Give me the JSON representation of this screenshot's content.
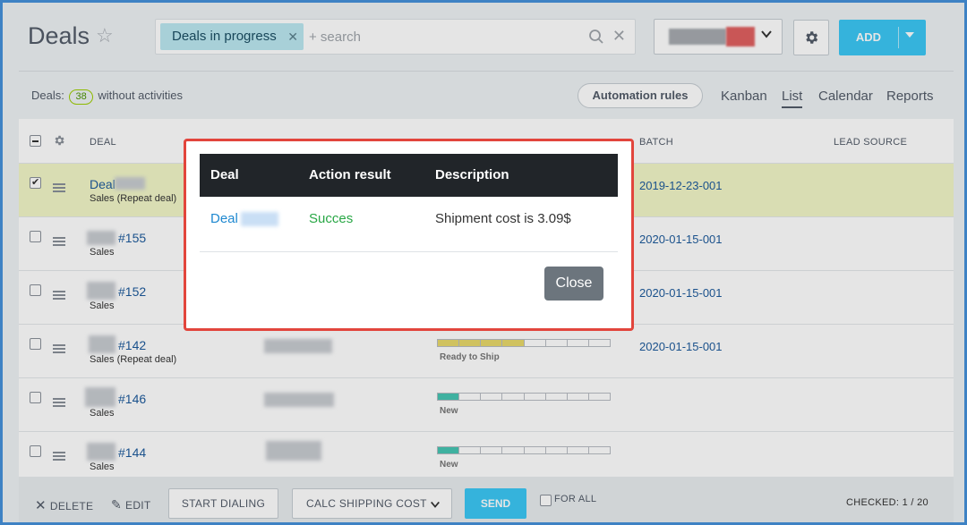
{
  "header": {
    "title": "Deals",
    "filter_tag": "Deals in progress",
    "search_placeholder": "+ search",
    "add_label": "ADD"
  },
  "toolbar": {
    "counter_prefix": "Deals:",
    "counter_value": "38",
    "counter_suffix": "without activities",
    "automation_label": "Automation rules",
    "views": [
      "Kanban",
      "List",
      "Calendar",
      "Reports"
    ],
    "active_view": "List"
  },
  "table": {
    "columns": {
      "deal": "DEAL",
      "batch": "BATCH",
      "lead_source": "LEAD SOURCE"
    },
    "rows": [
      {
        "title": "Deal",
        "subtitle": "Sales (Repeat deal)",
        "batch": "2019-12-23-001",
        "checked": true
      },
      {
        "title": "#155",
        "subtitle": "Sales",
        "batch": "2020-01-15-001",
        "checked": false
      },
      {
        "title": "#152",
        "subtitle": "Sales",
        "batch": "2020-01-15-001",
        "checked": false
      },
      {
        "title": "#142",
        "subtitle": "Sales (Repeat deal)",
        "batch": "2020-01-15-001",
        "checked": false,
        "stage": "Ready to Ship",
        "stage_progress": 0.55
      },
      {
        "title": "#146",
        "subtitle": "Sales",
        "batch": "",
        "checked": false,
        "stage": "New",
        "stage_progress": 0.15
      },
      {
        "title": "#144",
        "subtitle": "Sales",
        "batch": "",
        "checked": false,
        "stage": "New",
        "stage_progress": 0.15
      }
    ]
  },
  "footer": {
    "delete": "DELETE",
    "edit": "EDIT",
    "start_dialing": "START DIALING",
    "action_select": "CALC SHIPPING COST",
    "send": "SEND",
    "for_all": "FOR ALL",
    "checked": "CHECKED: 1 / 20"
  },
  "modal": {
    "headers": {
      "deal": "Deal",
      "result": "Action result",
      "description": "Description"
    },
    "row": {
      "deal": "Deal",
      "result": "Succes",
      "description": "Shipment cost is 3.09$"
    },
    "close_label": "Close"
  },
  "colors": {
    "accent": "#3bc8f5",
    "link": "#1e5b9c",
    "success": "#28a745",
    "modal_border": "#e2453c"
  }
}
